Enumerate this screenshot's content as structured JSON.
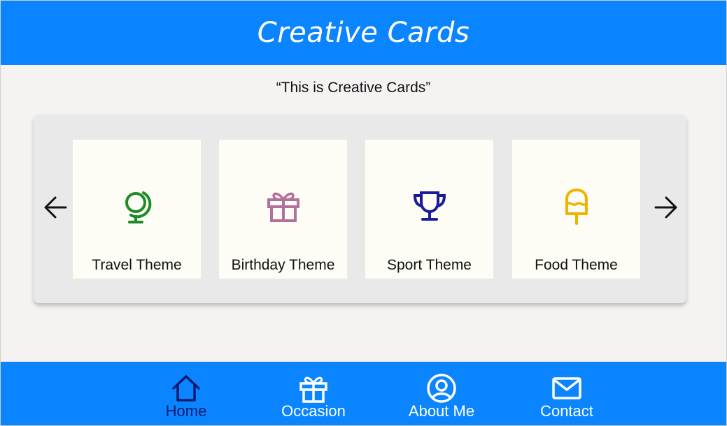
{
  "header": {
    "title": "Creative Cards"
  },
  "intro": {
    "text": "“This is Creative Cards”"
  },
  "carousel": {
    "prev_icon": "arrow-left-icon",
    "next_icon": "arrow-right-icon",
    "cards": [
      {
        "label": "Travel Theme",
        "icon": "globe-icon",
        "color": "#1f8a2a"
      },
      {
        "label": "Birthday Theme",
        "icon": "gift-icon",
        "color": "#b2719b"
      },
      {
        "label": "Sport Theme",
        "icon": "trophy-icon",
        "color": "#1a1a9a"
      },
      {
        "label": "Food Theme",
        "icon": "ice-cream-icon",
        "color": "#f2b200"
      }
    ]
  },
  "nav": {
    "items": [
      {
        "label": "Home",
        "icon": "home-icon",
        "active": true
      },
      {
        "label": "Occasion",
        "icon": "gift-icon",
        "active": false
      },
      {
        "label": "About Me",
        "icon": "user-icon",
        "active": false
      },
      {
        "label": "Contact",
        "icon": "envelope-icon",
        "active": false
      }
    ]
  },
  "colors": {
    "primary": "#0a84ff",
    "active_nav": "#0d1b70",
    "background": "#f5f2f2",
    "card": "#fdfdf6"
  }
}
